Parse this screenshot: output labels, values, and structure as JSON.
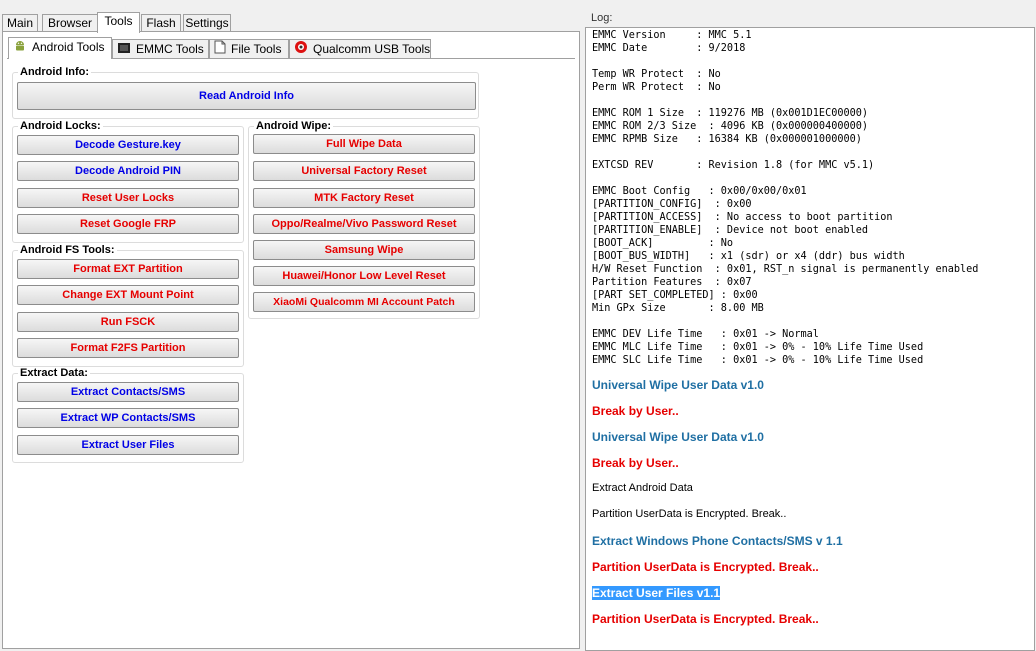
{
  "top_tabs": [
    "Main",
    "Browser",
    "Tools",
    "Flash",
    "Settings"
  ],
  "sub_tabs": [
    "Android Tools",
    "EMMC Tools",
    "File Tools",
    "Qualcomm USB Tools"
  ],
  "groups": {
    "android_info": {
      "label": "Android Info:",
      "buttons": [
        "Read Android Info"
      ]
    },
    "android_locks": {
      "label": "Android Locks:",
      "buttons": [
        "Decode Gesture.key",
        "Decode Android PIN",
        "Reset User Locks",
        "Reset Google FRP"
      ]
    },
    "android_fs": {
      "label": "Android FS Tools:",
      "buttons": [
        "Format EXT Partition",
        "Change EXT Mount Point",
        "Run FSCK",
        "Format F2FS Partition"
      ]
    },
    "extract_data": {
      "label": "Extract Data:",
      "buttons": [
        "Extract Contacts/SMS",
        "Extract WP Contacts/SMS",
        "Extract User Files"
      ]
    },
    "android_wipe": {
      "label": "Android Wipe:",
      "buttons": [
        "Full Wipe Data",
        "Universal Factory Reset",
        "MTK Factory Reset",
        "Oppo/Realme/Vivo Password Reset",
        "Samsung Wipe",
        "Huawei/Honor Low Level Reset",
        "XiaoMi Qualcomm MI Account Patch"
      ]
    }
  },
  "log": {
    "title": "Log:",
    "mono_lines": [
      "EMMC Version     : MMC 5.1",
      "EMMC Date        : 9/2018",
      "",
      "Temp WR Protect  : No",
      "Perm WR Protect  : No",
      "",
      "EMMC ROM 1 Size  : 119276 MB (0x001D1EC00000)",
      "EMMC ROM 2/3 Size  : 4096 KB (0x000000400000)",
      "EMMC RPMB Size   : 16384 KB (0x000001000000)",
      "",
      "EXTCSD REV       : Revision 1.8 (for MMC v5.1)",
      "",
      "EMMC Boot Config   : 0x00/0x00/0x01",
      "[PARTITION_CONFIG]  : 0x00",
      "[PARTITION_ACCESS]  : No access to boot partition",
      "[PARTITION_ENABLE]  : Device not boot enabled",
      "[BOOT_ACK]         : No",
      "[BOOT_BUS_WIDTH]   : x1 (sdr) or x4 (ddr) bus width",
      "H/W Reset Function  : 0x01, RST_n signal is permanently enabled",
      "Partition Features  : 0x07",
      "[PART SET_COMPLETED] : 0x00",
      "Min GPx Size       : 8.00 MB",
      "",
      "EMMC DEV Life Time   : 0x01 -> Normal",
      "EMMC MLC Life Time   : 0x01 -> 0% - 10% Life Time Used",
      "EMMC SLC Life Time   : 0x01 -> 0% - 10% Life Time Used"
    ],
    "messages": [
      {
        "text": "Universal Wipe User Data v1.0",
        "style": "bblue"
      },
      {
        "text": "Break by User..",
        "style": "bred"
      },
      {
        "text": "Universal Wipe User Data v1.0",
        "style": "bblue"
      },
      {
        "text": "Break by User..",
        "style": "bred"
      },
      {
        "text": "Extract Android Data",
        "style": "plain"
      },
      {
        "text": "Partition UserData is Encrypted. Break..",
        "style": "plain"
      },
      {
        "text": "Extract Windows Phone Contacts/SMS v 1.1",
        "style": "bblue"
      },
      {
        "text": "Partition UserData is Encrypted. Break..",
        "style": "bred"
      },
      {
        "text": "Extract User Files v1.1",
        "style": "sel"
      },
      {
        "text": "Partition UserData is Encrypted. Break..",
        "style": "bred"
      }
    ]
  }
}
